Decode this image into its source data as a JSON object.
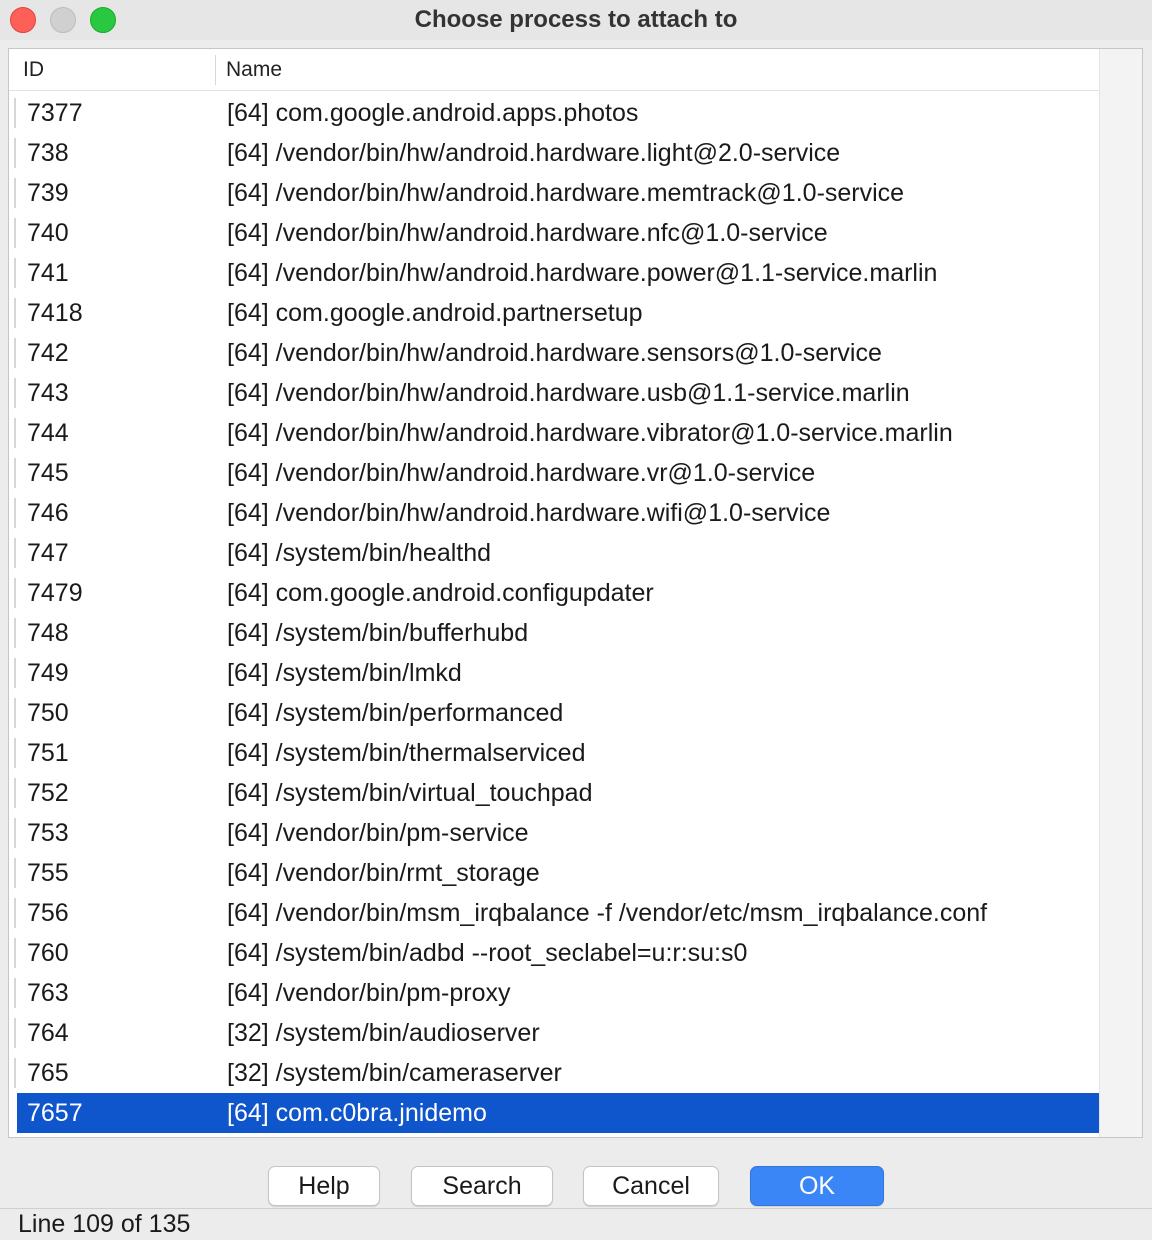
{
  "window": {
    "title": "Choose process to attach to"
  },
  "table": {
    "columns": {
      "id": "ID",
      "name": "Name"
    },
    "rows": [
      {
        "id": "7377",
        "name": "[64] com.google.android.apps.photos"
      },
      {
        "id": "738",
        "name": "[64] /vendor/bin/hw/android.hardware.light@2.0-service"
      },
      {
        "id": "739",
        "name": "[64] /vendor/bin/hw/android.hardware.memtrack@1.0-service"
      },
      {
        "id": "740",
        "name": "[64] /vendor/bin/hw/android.hardware.nfc@1.0-service"
      },
      {
        "id": "741",
        "name": "[64] /vendor/bin/hw/android.hardware.power@1.1-service.marlin"
      },
      {
        "id": "7418",
        "name": "[64] com.google.android.partnersetup"
      },
      {
        "id": "742",
        "name": "[64] /vendor/bin/hw/android.hardware.sensors@1.0-service"
      },
      {
        "id": "743",
        "name": "[64] /vendor/bin/hw/android.hardware.usb@1.1-service.marlin"
      },
      {
        "id": "744",
        "name": "[64] /vendor/bin/hw/android.hardware.vibrator@1.0-service.marlin"
      },
      {
        "id": "745",
        "name": "[64] /vendor/bin/hw/android.hardware.vr@1.0-service"
      },
      {
        "id": "746",
        "name": "[64] /vendor/bin/hw/android.hardware.wifi@1.0-service"
      },
      {
        "id": "747",
        "name": "[64] /system/bin/healthd"
      },
      {
        "id": "7479",
        "name": "[64] com.google.android.configupdater"
      },
      {
        "id": "748",
        "name": "[64] /system/bin/bufferhubd"
      },
      {
        "id": "749",
        "name": "[64] /system/bin/lmkd"
      },
      {
        "id": "750",
        "name": "[64] /system/bin/performanced"
      },
      {
        "id": "751",
        "name": "[64] /system/bin/thermalserviced"
      },
      {
        "id": "752",
        "name": "[64] /system/bin/virtual_touchpad"
      },
      {
        "id": "753",
        "name": "[64] /vendor/bin/pm-service"
      },
      {
        "id": "755",
        "name": "[64] /vendor/bin/rmt_storage"
      },
      {
        "id": "756",
        "name": "[64] /vendor/bin/msm_irqbalance -f /vendor/etc/msm_irqbalance.conf"
      },
      {
        "id": "760",
        "name": "[64] /system/bin/adbd --root_seclabel=u:r:su:s0"
      },
      {
        "id": "763",
        "name": "[64] /vendor/bin/pm-proxy"
      },
      {
        "id": "764",
        "name": "[32] /system/bin/audioserver"
      },
      {
        "id": "765",
        "name": "[32] /system/bin/cameraserver"
      },
      {
        "id": "7657",
        "name": "[64] com.c0bra.jnidemo",
        "selected": true
      }
    ]
  },
  "buttons": {
    "help": "Help",
    "search": "Search",
    "cancel": "Cancel",
    "ok": "OK"
  },
  "status": {
    "text": "Line 109 of 135"
  },
  "colors": {
    "selection": "#0f55cc",
    "primary_button": "#3a86f6"
  }
}
